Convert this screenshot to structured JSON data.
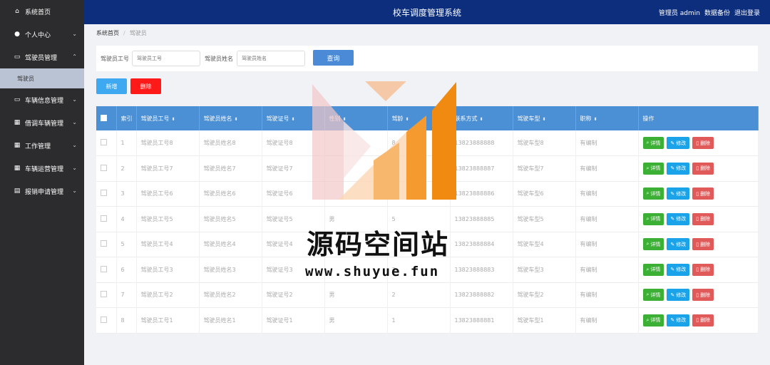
{
  "sidebar": {
    "items": [
      {
        "label": "系统首页",
        "icon": "home-icon",
        "chevron": ""
      },
      {
        "label": "个人中心",
        "icon": "user-icon",
        "chevron": "⌄"
      },
      {
        "label": "驾驶员管理",
        "icon": "monitor-icon",
        "chevron": "⌃"
      },
      {
        "label": "车辆信息管理",
        "icon": "monitor-icon",
        "chevron": "⌄"
      },
      {
        "label": "借调车辆管理",
        "icon": "grid-icon",
        "chevron": "⌄"
      },
      {
        "label": "工作管理",
        "icon": "grid-icon",
        "chevron": "⌄"
      },
      {
        "label": "车辆运营管理",
        "icon": "grid-icon",
        "chevron": "⌄"
      },
      {
        "label": "报销申请管理",
        "icon": "clipboard-icon",
        "chevron": "⌄"
      }
    ],
    "sub_item": "驾驶员"
  },
  "header": {
    "title": "校车调度管理系统",
    "user": "管理员 admin",
    "backup": "数据备份",
    "logout": "退出登录"
  },
  "breadcrumb": {
    "home": "系统首页",
    "current": "驾驶员"
  },
  "search": {
    "id_label": "驾驶员工号",
    "id_placeholder": "驾驶员工号",
    "name_label": "驾驶员姓名",
    "name_placeholder": "驾驶员姓名",
    "query": "查询"
  },
  "actions": {
    "add": "新增",
    "delete": "删除"
  },
  "table": {
    "headers": [
      "索引",
      "驾驶员工号",
      "驾驶员姓名",
      "驾驶证号",
      "性别",
      "驾龄",
      "联系方式",
      "驾驶车型",
      "职称",
      "操作"
    ],
    "op_detail": "详情",
    "op_edit": "修改",
    "op_delete": "删除",
    "rows": [
      {
        "idx": "1",
        "id": "驾驶员工号8",
        "name": "驾驶员姓名8",
        "license": "驾驶证号8",
        "gender": "",
        "years": "8",
        "phone": "13823888888",
        "car": "驾驶车型8",
        "title": "有编制"
      },
      {
        "idx": "2",
        "id": "驾驶员工号7",
        "name": "驾驶员姓名7",
        "license": "驾驶证号7",
        "gender": "",
        "years": "",
        "phone": "13823888887",
        "car": "驾驶车型7",
        "title": "有编制"
      },
      {
        "idx": "3",
        "id": "驾驶员工号6",
        "name": "驾驶员姓名6",
        "license": "驾驶证号6",
        "gender": "",
        "years": "",
        "phone": "13823888886",
        "car": "驾驶车型6",
        "title": "有编制"
      },
      {
        "idx": "4",
        "id": "驾驶员工号5",
        "name": "驾驶员姓名5",
        "license": "驾驶证号5",
        "gender": "男",
        "years": "5",
        "phone": "13823888885",
        "car": "驾驶车型5",
        "title": "有编制"
      },
      {
        "idx": "5",
        "id": "驾驶员工号4",
        "name": "驾驶员姓名4",
        "license": "驾驶证号4",
        "gender": "",
        "years": "",
        "phone": "13823888884",
        "car": "驾驶车型4",
        "title": "有编制"
      },
      {
        "idx": "6",
        "id": "驾驶员工号3",
        "name": "驾驶员姓名3",
        "license": "驾驶证号3",
        "gender": "",
        "years": "3",
        "phone": "13823888883",
        "car": "驾驶车型3",
        "title": "有编制"
      },
      {
        "idx": "7",
        "id": "驾驶员工号2",
        "name": "驾驶员姓名2",
        "license": "驾驶证号2",
        "gender": "男",
        "years": "2",
        "phone": "13823888882",
        "car": "驾驶车型2",
        "title": "有编制"
      },
      {
        "idx": "8",
        "id": "驾驶员工号1",
        "name": "驾驶员姓名1",
        "license": "驾驶证号1",
        "gender": "男",
        "years": "1",
        "phone": "13823888881",
        "car": "驾驶车型1",
        "title": "有编制"
      }
    ]
  },
  "watermark": {
    "text": "源码空间站",
    "url": "www.shuyue.fun"
  },
  "colors": {
    "header": "#0c2e7c",
    "sidebar": "#2c2c2e",
    "table_head": "#4b8fd4",
    "detail": "#3cb034",
    "edit": "#1aa3e8",
    "remove": "#e05a5a",
    "add": "#3ea8f0",
    "delete": "#ff1a1a"
  }
}
